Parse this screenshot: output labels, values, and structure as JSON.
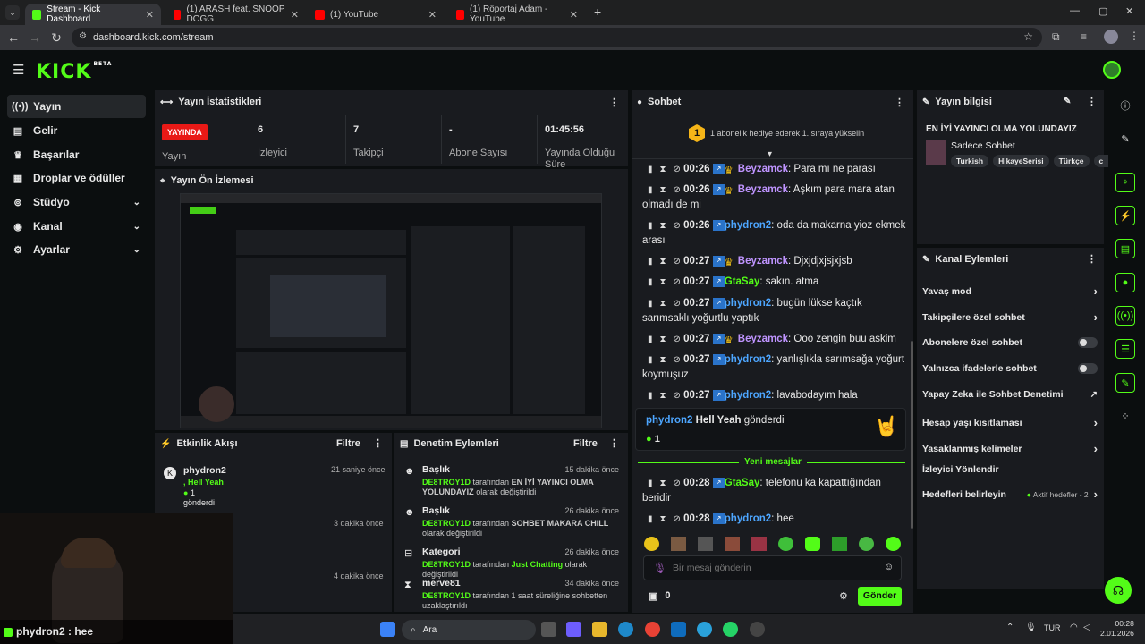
{
  "browser": {
    "tabs": [
      {
        "title": "Stream - Kick Dashboard"
      },
      {
        "title": "(1) ARASH feat. SNOOP DOGG"
      },
      {
        "title": "(1) YouTube"
      },
      {
        "title": "(1) Röportaj Adam - YouTube"
      }
    ],
    "url": "dashboard.kick.com/stream"
  },
  "header": {
    "logo": "KICK",
    "logo_sup": "BETA"
  },
  "sidebar": {
    "items": [
      {
        "label": "Yayın",
        "icon": "broadcast-icon"
      },
      {
        "label": "Gelir",
        "icon": "revenue-icon"
      },
      {
        "label": "Başarılar",
        "icon": "trophy-icon"
      },
      {
        "label": "Droplar ve ödüller",
        "icon": "gift-icon"
      },
      {
        "label": "Stüdyo",
        "icon": "studio-icon"
      },
      {
        "label": "Kanal",
        "icon": "channel-icon"
      },
      {
        "label": "Ayarlar",
        "icon": "gear-icon"
      }
    ]
  },
  "stats": {
    "title": "Yayın İstatistikleri",
    "live": "YAYINDA",
    "live_label": "Yayın",
    "viewers": "6",
    "viewers_label": "İzleyici",
    "followers": "7",
    "followers_label": "Takipçi",
    "subs": "-",
    "subs_label": "Abone Sayısı",
    "uptime": "01:45:56",
    "uptime_label": "Yayında Olduğu Süre"
  },
  "preview": {
    "title": "Yayın Ön İzlemesi"
  },
  "activity": {
    "title": "Etkinlik Akışı",
    "filter": "Filtre",
    "events": [
      {
        "user": "phydron2",
        "text": ", Hell Yeah",
        "count": "1",
        "suffix": "gönderdi",
        "time": "21 saniye önce"
      },
      {
        "time": "3 dakika önce"
      },
      {
        "time": "4 dakika önce"
      }
    ]
  },
  "audit": {
    "title": "Denetim Eylemleri",
    "filter": "Filtre",
    "items": [
      {
        "type": "Başlık",
        "ago": "15 dakika önce",
        "actor": "DE8TROY1D",
        "mid": " tarafından ",
        "value": "EN İYİ YAYINCI OLMA YOLUNDAYIZ",
        "tail": " olarak değiştirildi"
      },
      {
        "type": "Başlık",
        "ago": "26 dakika önce",
        "actor": "DE8TROY1D",
        "mid": " tarafından ",
        "value": "SOHBET MAKARA CHILL",
        "tail": " olarak değiştirildi"
      },
      {
        "type": "Kategori",
        "ago": "26 dakika önce",
        "actor": "DE8TROY1D",
        "mid": " tarafından ",
        "value": "Just Chatting",
        "tail": " olarak değiştirildi"
      },
      {
        "type": "merve81",
        "ago": "34 dakika önce",
        "actor": "DE8TROY1D",
        "mid": " tarafından 1 saat süreliğine sohbetten uzaklaştırıldı",
        "value": "",
        "tail": ""
      }
    ]
  },
  "chat": {
    "title": "Sohbet",
    "gift_rank": "1",
    "gift_text": "1 abonelik hediye ederek 1. sıraya yükselin",
    "messages": [
      {
        "time": "00:26",
        "user": "Beyzamck",
        "color": "p",
        "crown": true,
        "text": ": Para mı ne parası"
      },
      {
        "time": "00:26",
        "user": "Beyzamck",
        "color": "p",
        "crown": true,
        "text": ": Aşkım para mara atan olmadı de mi"
      },
      {
        "time": "00:26",
        "user": "phydron2",
        "color": "b",
        "crown": false,
        "text": ": oda da makarna yioz ekmek arası"
      },
      {
        "time": "00:27",
        "user": "Beyzamck",
        "color": "p",
        "crown": true,
        "text": ": Djxjdjxjsjxjsb"
      },
      {
        "time": "00:27",
        "user": "GtaSay",
        "color": "g",
        "crown": false,
        "text": ": sakın. atma"
      },
      {
        "time": "00:27",
        "user": "phydron2",
        "color": "b",
        "crown": false,
        "text": ": bugün lükse kaçtık sarımsaklı yoğurtlu yaptık"
      },
      {
        "time": "00:27",
        "user": "Beyzamck",
        "color": "p",
        "crown": true,
        "text": ": Ooo zengin buu askim"
      },
      {
        "time": "00:27",
        "user": "phydron2",
        "color": "b",
        "crown": false,
        "text": ": yanlışlıkla sarımsağa yoğurt koymuşuz"
      },
      {
        "time": "00:27",
        "user": "phydron2",
        "color": "b",
        "crown": false,
        "text": ": lavabodayım hala"
      }
    ],
    "gift_card": {
      "user": "phydron2",
      "item": "Hell Yeah",
      "verb": "gönderdi",
      "count": "1"
    },
    "new_messages": "Yeni mesajlar",
    "messages2": [
      {
        "time": "00:28",
        "user": "GtaSay",
        "color": "g",
        "text": ": telefonu ka kapattığından beridir"
      },
      {
        "time": "00:28",
        "user": "phydron2",
        "color": "b",
        "text": ": hee"
      }
    ],
    "input_placeholder": "Bir mesaj gönderin",
    "points": "0",
    "send": "Gönder"
  },
  "stream_info": {
    "title": "Yayın bilgisi",
    "stream_title": "EN İYİ YAYINCI OLMA YOLUNDAYIZ",
    "category": "Sadece Sohbet",
    "tags": [
      "Turkish",
      "HikayeSerisi",
      "Türkçe",
      "c"
    ]
  },
  "channel_actions": {
    "title": "Kanal Eylemleri",
    "items": [
      {
        "label": "Yavaş mod",
        "ctrl": "chevron"
      },
      {
        "label": "Takipçilere özel sohbet",
        "ctrl": "chevron"
      },
      {
        "label": "Abonelere özel sohbet",
        "ctrl": "toggle"
      },
      {
        "label": "Yalnızca ifadelerle sohbet",
        "ctrl": "toggle"
      },
      {
        "label": "Yapay Zeka ile Sohbet Denetimi",
        "ctrl": "external"
      },
      {
        "label": "Hesap yaşı kısıtlaması",
        "ctrl": "chevron"
      },
      {
        "label": "Yasaklanmış kelimeler",
        "ctrl": "chevron"
      },
      {
        "label": "İzleyici Yönlendir",
        "ctrl": "none"
      },
      {
        "label": "Hedefleri belirleyin",
        "ctrl": "chevron",
        "extra": "Aktif hedefler - 2"
      }
    ]
  },
  "overlay": {
    "caption": "phydron2 : hee"
  },
  "taskbar": {
    "search": "Ara",
    "lang": "TUR",
    "time": "00:28",
    "date": "2.01.2026"
  },
  "colors": {
    "brand": "#53fc18",
    "live": "#e91916",
    "panel": "#191b1f",
    "bg": "#0b0e0f"
  }
}
